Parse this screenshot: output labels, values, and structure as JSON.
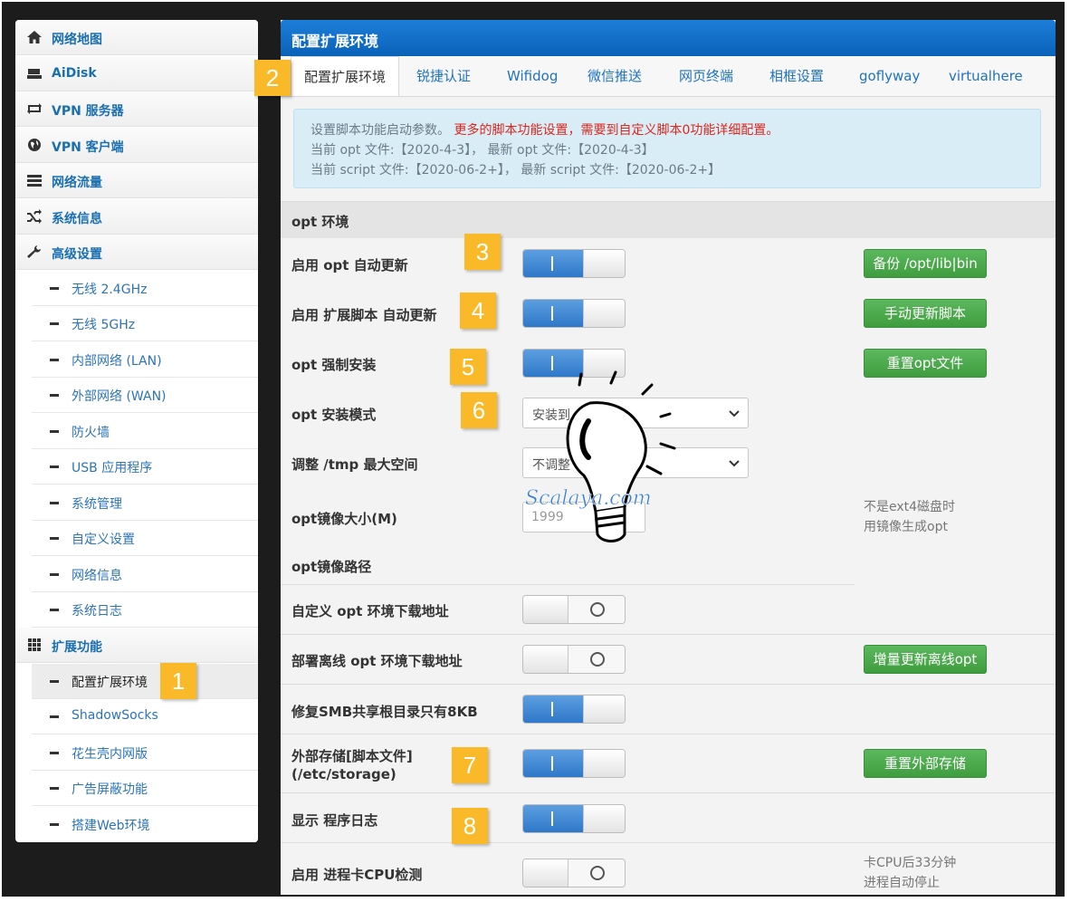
{
  "sidebar": {
    "items": [
      {
        "label": "网络地图",
        "icon": "home-icon"
      },
      {
        "label": "AiDisk",
        "icon": "disk-icon"
      },
      {
        "label": "VPN 服务器",
        "icon": "vpn-server-icon"
      },
      {
        "label": "VPN 客户端",
        "icon": "globe-icon"
      },
      {
        "label": "网络流量",
        "icon": "traffic-icon"
      },
      {
        "label": "系统信息",
        "icon": "shuffle-icon"
      },
      {
        "label": "高级设置",
        "icon": "wrench-icon"
      }
    ],
    "advanced_sub": [
      "无线 2.4GHz",
      "无线 5GHz",
      "内部网络 (LAN)",
      "外部网络 (WAN)",
      "防火墙",
      "USB 应用程序",
      "系统管理",
      "自定义设置",
      "网络信息",
      "系统日志"
    ],
    "extensions": {
      "label": "扩展功能",
      "icon": "grid-icon"
    },
    "extensions_sub": [
      "配置扩展环境",
      "ShadowSocks",
      "花生壳内网版",
      "广告屏蔽功能",
      "搭建Web环境"
    ]
  },
  "main": {
    "title": "配置扩展环境",
    "tabs": [
      "配置扩展环境",
      "锐捷认证",
      "Wifidog",
      "微信推送",
      "网页终端",
      "相框设置",
      "goflyway",
      "virtualhere"
    ],
    "info": {
      "line1_gray": "设置脚本功能启动参数。",
      "line1_red": "更多的脚本功能设置，需要到自定义脚本0功能详细配置。",
      "line2": "当前 opt 文件:【2020-4-3】， 最新 opt 文件:【2020-4-3】",
      "line3": "当前 script 文件:【2020-06-2+】， 最新 script 文件:【2020-06-2+】"
    },
    "section": "opt 环境",
    "rows": {
      "opt_update": "启用 opt 自动更新",
      "script_update": "启用 扩展脚本 自动更新",
      "opt_force": "opt 强制安装",
      "opt_mode": "opt 安装模式",
      "tmp_adjust": "调整 /tmp 最大空间",
      "opt_image_size": "opt镜像大小(M)",
      "opt_image_path": "opt镜像路径",
      "custom_opt_url": "自定义 opt 环境下载地址",
      "offline_opt_url": "部署离线 opt 环境下载地址",
      "smb_fix": "修复SMB共享根目录只有8KB",
      "ext_storage_1": "外部存储[脚本文件]",
      "ext_storage_2": "(/etc/storage)",
      "show_log": "显示 程序日志",
      "cpu_check": "启用 进程卡CPU检测"
    },
    "toggles": {
      "opt_update": true,
      "script_update": true,
      "opt_force": true,
      "custom_opt_url": false,
      "offline_opt_url": false,
      "smb_fix": true,
      "ext_storage": true,
      "show_log": true,
      "cpu_check": false
    },
    "buttons": {
      "backup": "备份 /opt/lib|bin",
      "manual_update": "手动更新脚本",
      "reset_opt": "重置opt文件",
      "incremental_update": "增量更新离线opt",
      "reset_storage": "重置外部存储"
    },
    "selects": {
      "opt_mode": "安装到",
      "tmp_adjust": "不调整"
    },
    "opt_image_size_value": "1999",
    "notes": {
      "ext4_1": "不是ext4磁盘时",
      "ext4_2": "用镜像生成opt",
      "cpu_1": "卡CPU后33分钟",
      "cpu_2": "进程自动停止"
    }
  },
  "badges": [
    "1",
    "2",
    "3",
    "4",
    "5",
    "6",
    "7",
    "8"
  ],
  "watermark": "Scalaya.com",
  "colors": {
    "accent": "#1a6fb0",
    "title_bar": "#0a62b8",
    "green": "#4cae4c",
    "badge": "#f9b929",
    "toggle_on": "#2f78c9"
  }
}
